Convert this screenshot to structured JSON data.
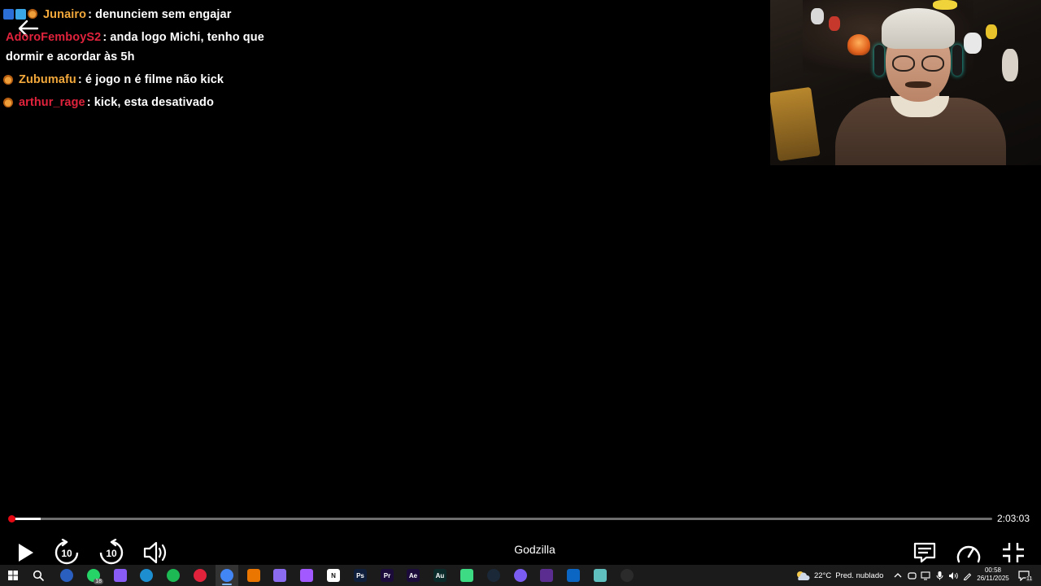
{
  "chat": {
    "messages": [
      {
        "badges": [
          "blue",
          "cyan",
          "cat"
        ],
        "user": "Junairo",
        "user_color": "#f2a83b",
        "text": ": denunciem sem engajar"
      },
      {
        "badges": [],
        "user": "AdoroFemboyS2",
        "user_color": "#e0233c",
        "text": ": anda logo Michi, tenho que dormir e acordar às 5h"
      },
      {
        "badges": [
          "cat"
        ],
        "user": "Zubumafu",
        "user_color": "#f2a83b",
        "text": ": é jogo n é filme não kick"
      },
      {
        "badges": [
          "cat"
        ],
        "user": "arthur_rage",
        "user_color": "#e0233c",
        "text": ": kick, esta desativado"
      }
    ]
  },
  "player": {
    "title": "Godzilla",
    "time_remaining": "2:03:03",
    "progress_fraction": 0.03,
    "rewind_seconds": "10",
    "forward_seconds": "10",
    "accent": "#e50914"
  },
  "taskbar": {
    "apps": [
      {
        "name": "chrome-canary",
        "color": "#2a5fbf",
        "label": ""
      },
      {
        "name": "whatsapp",
        "color": "#25d366",
        "label": "",
        "badge": "18"
      },
      {
        "name": "copilot",
        "color": "#8a5cf6",
        "label": ""
      },
      {
        "name": "edge",
        "color": "#1d8fd1",
        "label": ""
      },
      {
        "name": "spotify",
        "color": "#1db954",
        "label": ""
      },
      {
        "name": "opera",
        "color": "#e0223b",
        "label": ""
      },
      {
        "name": "chrome",
        "color": "#4285f4",
        "label": "",
        "active": true
      },
      {
        "name": "blender",
        "color": "#ea7600",
        "label": ""
      },
      {
        "name": "crystal",
        "color": "#8b6cf0",
        "label": ""
      },
      {
        "name": "figma",
        "color": "#a259ff",
        "label": ""
      },
      {
        "name": "notion",
        "color": "#ffffff",
        "label": "N"
      },
      {
        "name": "photoshop",
        "color": "#0f1e3a",
        "label": "Ps"
      },
      {
        "name": "premiere",
        "color": "#1a0b3a",
        "label": "Pr"
      },
      {
        "name": "after-effects",
        "color": "#1a0b3a",
        "label": "Ae"
      },
      {
        "name": "audition",
        "color": "#0b2a2a",
        "label": "Au"
      },
      {
        "name": "android-studio",
        "color": "#3ddc84",
        "label": ""
      },
      {
        "name": "steam",
        "color": "#1b2838",
        "label": ""
      },
      {
        "name": "discord-ring",
        "color": "#7a5cf0",
        "label": ""
      },
      {
        "name": "visual-studio",
        "color": "#5c2d91",
        "label": ""
      },
      {
        "name": "vs-code",
        "color": "#0a66c2",
        "label": ""
      },
      {
        "name": "cursor-app",
        "color": "#5fbfbf",
        "label": ""
      },
      {
        "name": "obs",
        "color": "#2b2b2b",
        "label": ""
      }
    ],
    "weather_temp": "22°C",
    "weather_text": "Pred. nublado",
    "time": "00:58",
    "date": "26/11/2025",
    "notification_count": "11"
  }
}
